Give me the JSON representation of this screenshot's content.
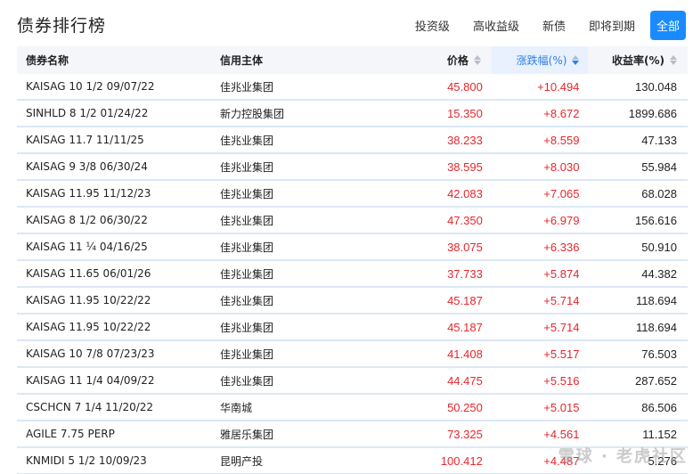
{
  "title": "债券排行榜",
  "tabs": [
    {
      "label": "投资级"
    },
    {
      "label": "高收益级"
    },
    {
      "label": "新债"
    },
    {
      "label": "即将到期"
    },
    {
      "label": "全部"
    }
  ],
  "columns": {
    "name": "债券名称",
    "issuer": "信用主体",
    "price": "价格",
    "change": "涨跌幅(%)",
    "yield": "收益率(%)"
  },
  "rows": [
    {
      "name": "KAISAG 10 1/2 09/07/22",
      "issuer": "佳兆业集团",
      "price": "45.800",
      "change": "+10.494",
      "yield": "130.048"
    },
    {
      "name": "SINHLD 8 1/2 01/24/22",
      "issuer": "新力控股集团",
      "price": "15.350",
      "change": "+8.672",
      "yield": "1899.686"
    },
    {
      "name": "KAISAG 11.7 11/11/25",
      "issuer": "佳兆业集团",
      "price": "38.233",
      "change": "+8.559",
      "yield": "47.133"
    },
    {
      "name": "KAISAG 9 3/8 06/30/24",
      "issuer": "佳兆业集团",
      "price": "38.595",
      "change": "+8.030",
      "yield": "55.984"
    },
    {
      "name": "KAISAG 11.95 11/12/23",
      "issuer": "佳兆业集团",
      "price": "42.083",
      "change": "+7.065",
      "yield": "68.028"
    },
    {
      "name": "KAISAG 8 1/2 06/30/22",
      "issuer": "佳兆业集团",
      "price": "47.350",
      "change": "+6.979",
      "yield": "156.616"
    },
    {
      "name": "KAISAG 11 ¼ 04/16/25",
      "issuer": "佳兆业集团",
      "price": "38.075",
      "change": "+6.336",
      "yield": "50.910"
    },
    {
      "name": "KAISAG 11.65 06/01/26",
      "issuer": "佳兆业集团",
      "price": "37.733",
      "change": "+5.874",
      "yield": "44.382"
    },
    {
      "name": "KAISAG 11.95 10/22/22",
      "issuer": "佳兆业集团",
      "price": "45.187",
      "change": "+5.714",
      "yield": "118.694"
    },
    {
      "name": "KAISAG 11.95 10/22/22",
      "issuer": "佳兆业集团",
      "price": "45.187",
      "change": "+5.714",
      "yield": "118.694"
    },
    {
      "name": "KAISAG 10 7/8 07/23/23",
      "issuer": "佳兆业集团",
      "price": "41.408",
      "change": "+5.517",
      "yield": "76.503"
    },
    {
      "name": "KAISAG 11 1/4 04/09/22",
      "issuer": "佳兆业集团",
      "price": "44.475",
      "change": "+5.516",
      "yield": "287.652"
    },
    {
      "name": "CSCHCN 7 1/4 11/20/22",
      "issuer": "华南城",
      "price": "50.250",
      "change": "+5.015",
      "yield": "86.506"
    },
    {
      "name": "AGILE 7.75 PERP",
      "issuer": "雅居乐集团",
      "price": "73.325",
      "change": "+4.561",
      "yield": "11.152"
    },
    {
      "name": "KNMIDI 5 1/2 10/09/23",
      "issuer": "昆明产投",
      "price": "100.412",
      "change": "+4.487",
      "yield": "5.276"
    }
  ],
  "watermark": "雪球 · 老虎社区"
}
